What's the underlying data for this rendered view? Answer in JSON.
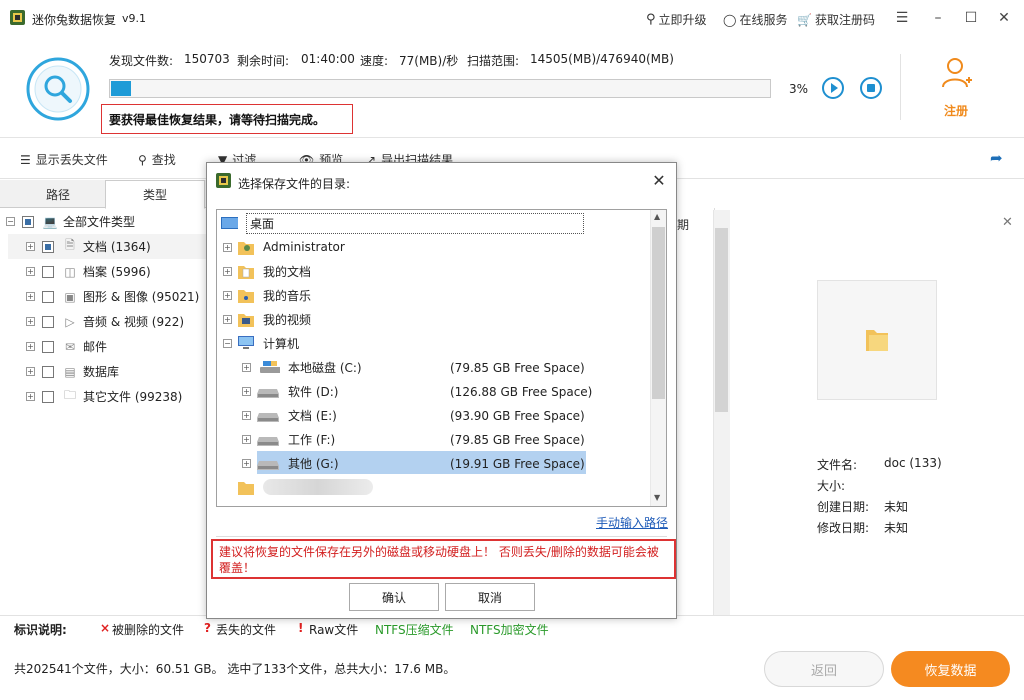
{
  "app": {
    "title": "迷你兔数据恢复",
    "version": "v9.1",
    "links": {
      "upgrade": "立即升级",
      "online_service": "在线服务",
      "get_code": "获取注册码"
    }
  },
  "scan": {
    "found_label": "发现文件数:",
    "found_value": "150703",
    "remaining_label": "剩余时间:",
    "remaining_value": "01:40:00",
    "speed_label": "速度:",
    "speed_value": "77(MB)/秒",
    "range_label": "扫描范围:",
    "range_value": "14505(MB)/476940(MB)",
    "progress_percent": 3,
    "progress_text": "3%",
    "hint": "要获得最佳恢复结果，请等待扫描完成。",
    "register_label": "注册"
  },
  "toolbar": {
    "show_lost": "显示丢失文件",
    "find": "查找",
    "filter": "过滤",
    "preview": "预览",
    "export": "导出扫描结果"
  },
  "tabs": {
    "path": "路径",
    "type": "类型"
  },
  "tree": [
    {
      "label": "全部文件类型"
    },
    {
      "label": "文档 (1364)"
    },
    {
      "label": "档案 (5996)"
    },
    {
      "label": "图形 & 图像 (95021)"
    },
    {
      "label": "音频 & 视频 (922)"
    },
    {
      "label": "邮件"
    },
    {
      "label": "数据库"
    },
    {
      "label": "其它文件 (99238)"
    }
  ],
  "list_header_fragment": "期",
  "details": {
    "name_label": "文件名:",
    "name_value": "doc (133)",
    "size_label": "大小:",
    "size_value": "",
    "created_label": "创建日期:",
    "created_value": "未知",
    "modified_label": "修改日期:",
    "modified_value": "未知"
  },
  "legend": {
    "title": "标识说明:",
    "deleted": "被删除的文件",
    "lost": "丢失的文件",
    "raw": "Raw文件",
    "ntfs_compressed": "NTFS压缩文件",
    "ntfs_encrypted": "NTFS加密文件",
    "colors": {
      "deleted": "#e02020",
      "lost": "#e02020",
      "raw": "#e02020",
      "ntfs": "#2a9a2a"
    }
  },
  "summary": "共202541个文件，大小：60.51 GB。 选中了133个文件，总共大小：17.6 MB。",
  "buttons": {
    "back": "返回",
    "recover": "恢复数据"
  },
  "dialog": {
    "title": "选择保存文件的目录:",
    "root": "桌面",
    "items": [
      {
        "label": "Administrator"
      },
      {
        "label": "我的文档"
      },
      {
        "label": "我的音乐"
      },
      {
        "label": "我的视频"
      },
      {
        "label": "计算机"
      }
    ],
    "drives": [
      {
        "label": "本地磁盘 (C:)",
        "free": "(79.85 GB Free Space)"
      },
      {
        "label": "软件 (D:)",
        "free": "(126.88 GB Free Space)"
      },
      {
        "label": "文档 (E:)",
        "free": "(93.90 GB Free Space)"
      },
      {
        "label": "工作 (F:)",
        "free": "(79.85 GB Free Space)"
      },
      {
        "label": "其他 (G:)",
        "free": "(19.91 GB Free Space)"
      }
    ],
    "manual_input": "手动输入路径",
    "warning": "建议将恢复的文件保存在另外的磁盘或移动硬盘上！ 否则丢失/删除的数据可能会被覆盖！",
    "ok": "确认",
    "cancel": "取消"
  },
  "colors": {
    "accent": "#1e9bd7",
    "orange": "#f58a20",
    "warn": "#d33333",
    "selected": "#b3d1f0"
  }
}
